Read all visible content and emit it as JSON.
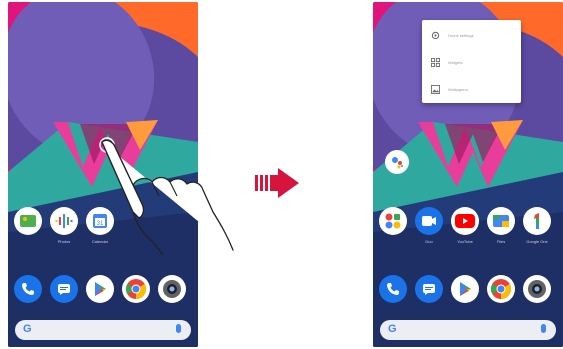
{
  "left_screen": {
    "dock_labels": [
      "Photos",
      "Calendar"
    ],
    "search_logo": "G",
    "icons": {
      "row1": [
        "photos-widget-icon",
        "podcasts-icon",
        "calendar-icon"
      ],
      "dock": [
        "phone-icon",
        "messages-icon",
        "play-store-icon",
        "chrome-icon",
        "camera-icon"
      ]
    }
  },
  "right_screen": {
    "popup_menu": {
      "items": [
        {
          "icon": "gear-icon",
          "label": "Home settings"
        },
        {
          "icon": "widgets-icon",
          "label": "Widgets"
        },
        {
          "icon": "wallpaper-icon",
          "label": "Wallpapers"
        }
      ]
    },
    "search_logo": "G",
    "app_labels": [
      "Duo",
      "YouTube",
      "Files",
      "Google One"
    ],
    "icons": {
      "row1": [
        "google-folder-icon",
        "duo-icon",
        "youtube-icon",
        "files-icon",
        "google-one-icon"
      ],
      "dock": [
        "phone-icon",
        "messages-icon",
        "play-store-icon",
        "chrome-icon",
        "camera-icon"
      ]
    }
  },
  "colors": {
    "arrow": "#d6153f",
    "wallpaper_magenta": "#e0147a",
    "wallpaper_purple": "#5a3f8f",
    "wallpaper_teal": "#2fa8a0"
  }
}
